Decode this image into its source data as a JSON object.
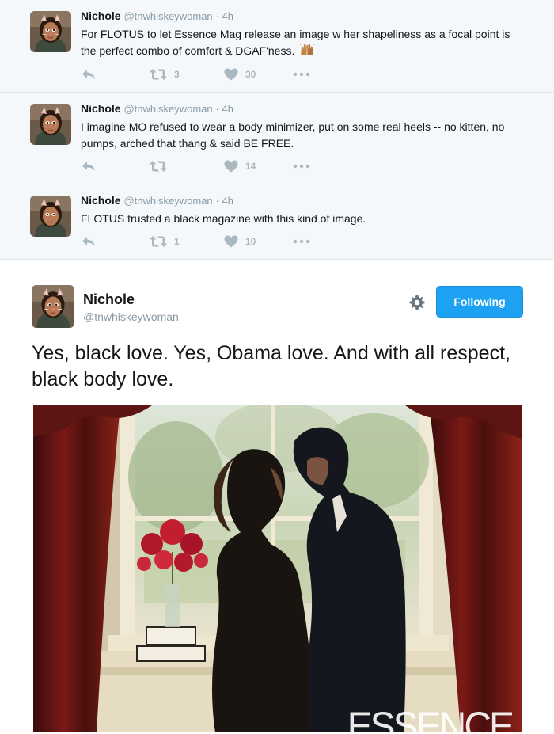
{
  "replies": [
    {
      "name": "Nichole",
      "handle": "@tnwhiskeywoman",
      "time": "· 4h",
      "text": "For FLOTUS to let Essence Mag release an image w her shapeliness as a focal point is the perfect combo of comfort & DGAF'ness.",
      "emoji": "raised-hands-emoji",
      "retweets": "3",
      "likes": "30"
    },
    {
      "name": "Nichole",
      "handle": "@tnwhiskeywoman",
      "time": "· 4h",
      "text": "I imagine MO refused to wear a body minimizer, put on some real heels -- no kitten, no pumps, arched that thang & said BE FREE.",
      "retweets": "",
      "likes": "14"
    },
    {
      "name": "Nichole",
      "handle": "@tnwhiskeywoman",
      "time": "· 4h",
      "text": "FLOTUS trusted a black magazine with this kind of image.",
      "retweets": "1",
      "likes": "10"
    }
  ],
  "main": {
    "name": "Nichole",
    "handle": "@tnwhiskeywoman",
    "follow_label": "Following",
    "text": "Yes, black love. Yes, Obama love. And with all respect, black body love.",
    "photo_watermark": "ESSENCE"
  },
  "colors": {
    "accent": "#1da1f2",
    "reply_bg": "#f5f8fa",
    "icon_gray": "#aab8c2"
  }
}
